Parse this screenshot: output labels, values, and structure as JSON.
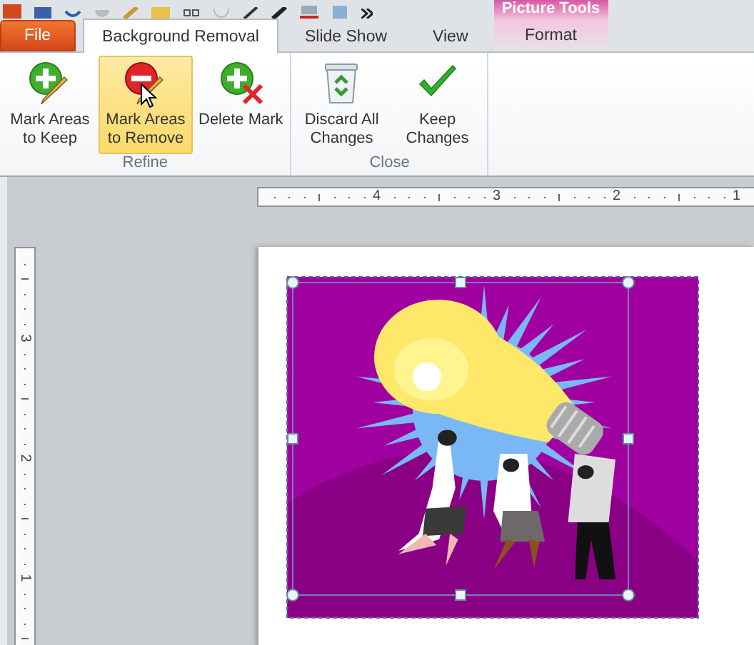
{
  "contextual_tab_group": {
    "title": "Picture Tools",
    "tabs": [
      {
        "label": "Format",
        "selected": false
      }
    ]
  },
  "tabs": [
    {
      "label": "File",
      "kind": "file",
      "selected": false
    },
    {
      "label": "Background Removal",
      "kind": "tab",
      "selected": true
    },
    {
      "label": "Slide Show",
      "kind": "tab",
      "selected": false
    },
    {
      "label": "View",
      "kind": "tab",
      "selected": false
    }
  ],
  "ribbon_groups": [
    {
      "label": "Refine",
      "buttons": [
        {
          "label": "Mark Areas to Keep",
          "kind": "plus-pencil",
          "highlighted": false
        },
        {
          "label": "Mark Areas to Remove",
          "kind": "minus-pencil",
          "highlighted": true
        },
        {
          "label": "Delete Mark",
          "kind": "plus-x",
          "highlighted": false
        }
      ]
    },
    {
      "label": "Close",
      "buttons": [
        {
          "label": "Discard All Changes",
          "kind": "recycle-bin",
          "highlighted": false
        },
        {
          "label": "Keep Changes",
          "kind": "check",
          "highlighted": false
        }
      ]
    }
  ],
  "horizontal_ruler": {
    "labels": [
      "4",
      "3",
      "2",
      "1"
    ]
  },
  "vertical_ruler": {
    "labels": [
      "3",
      "2",
      "1"
    ]
  }
}
